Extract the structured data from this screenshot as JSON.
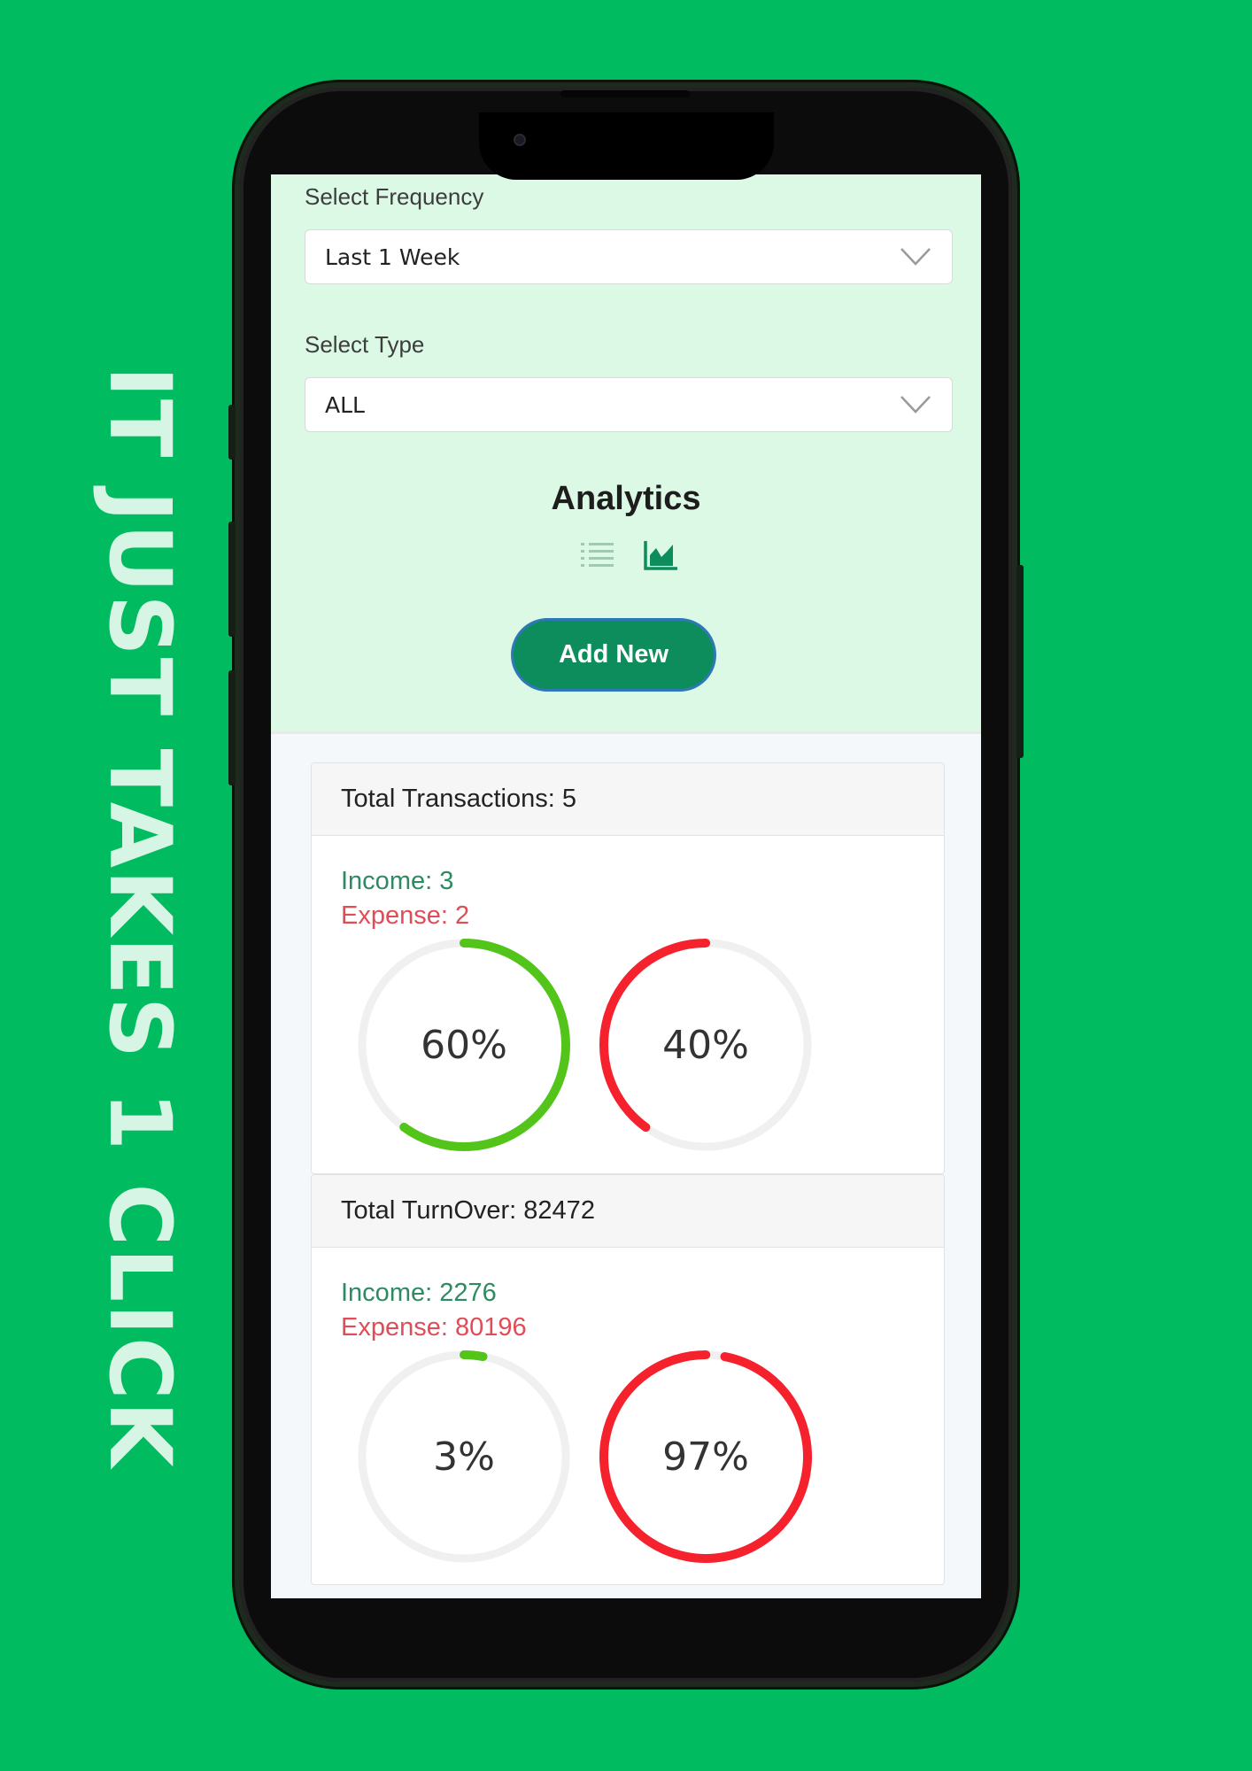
{
  "slogan": "IT JUST TAKES 1 CLICK",
  "filters": {
    "frequency_label": "Select Frequency",
    "frequency_value": "Last 1 Week",
    "type_label": "Select Type",
    "type_value": "ALL"
  },
  "analytics": {
    "title": "Analytics",
    "view_icons": [
      "list-view-icon",
      "chart-view-icon"
    ],
    "add_button": "Add New"
  },
  "transactions": {
    "header": "Total Transactions: 5",
    "income": "Income: 3",
    "expense": "Expense: 2",
    "income_percent": 60,
    "expense_percent": 40,
    "income_label": "60%",
    "expense_label": "40%"
  },
  "turnover": {
    "header": "Total TurnOver: 82472",
    "income": "Income: 2276",
    "expense": "Expense: 80196",
    "income_percent": 3,
    "expense_percent": 97,
    "income_label": "3%",
    "expense_label": "97%"
  },
  "colors": {
    "background": "#00bb5f",
    "income_ring": "#52c41a",
    "expense_ring": "#f5222d",
    "track": "#f0f0f0",
    "button": "#0d8d5b"
  }
}
